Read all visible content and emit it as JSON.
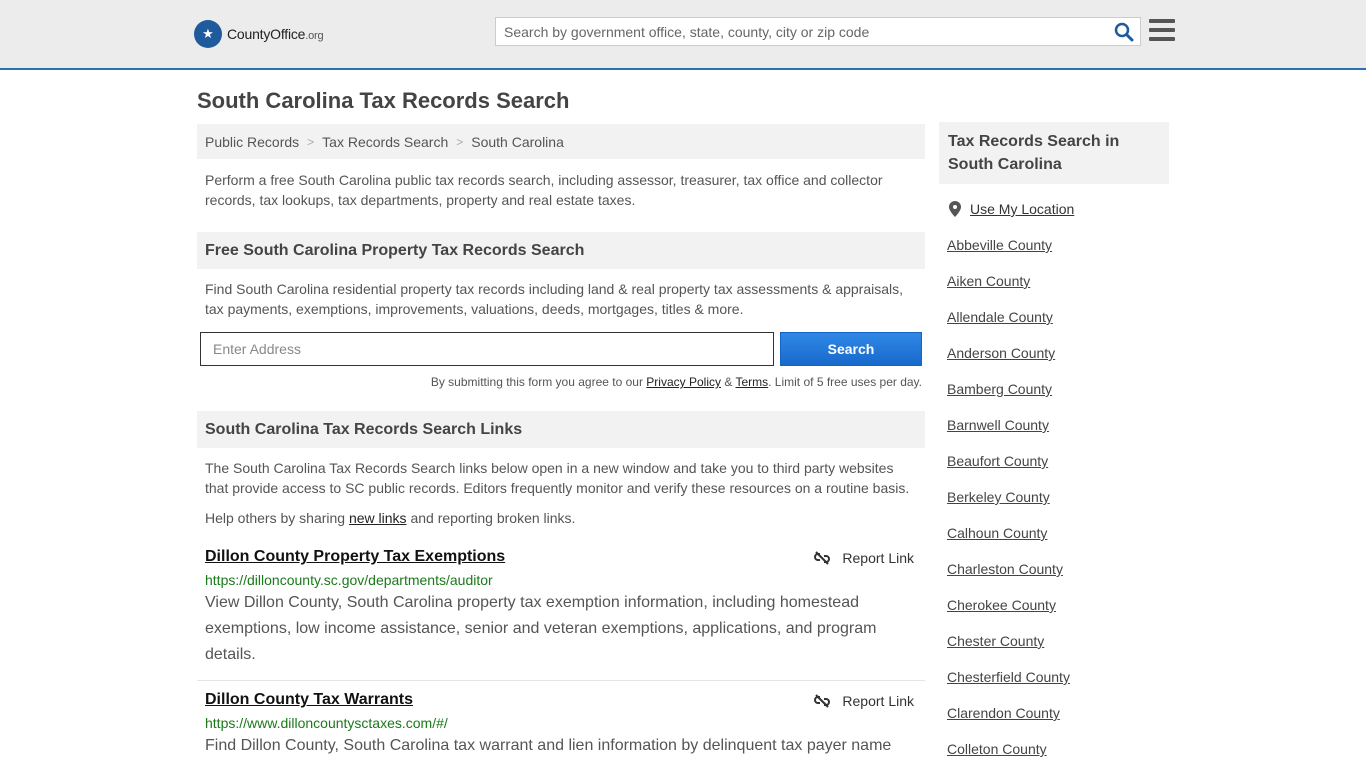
{
  "header": {
    "logo_main": "CountyOffice",
    "logo_tld": ".org",
    "search_placeholder": "Search by government office, state, county, city or zip code"
  },
  "page": {
    "title": "South Carolina Tax Records Search",
    "breadcrumb": [
      "Public Records",
      "Tax Records Search",
      "South Carolina"
    ],
    "intro": "Perform a free South Carolina public tax records search, including assessor, treasurer, tax office and collector records, tax lookups, tax departments, property and real estate taxes."
  },
  "property_search": {
    "heading": "Free South Carolina Property Tax Records Search",
    "description": "Find South Carolina residential property tax records including land & real property tax assessments & appraisals, tax payments, exemptions, improvements, valuations, deeds, mortgages, titles & more.",
    "input_placeholder": "Enter Address",
    "button_label": "Search",
    "terms_prefix": "By submitting this form you agree to our",
    "privacy_label": "Privacy Policy",
    "terms_amp": "&",
    "terms_label": "Terms",
    "terms_suffix": ". Limit of 5 free uses per day."
  },
  "links_section": {
    "heading": "South Carolina Tax Records Search Links",
    "description": "The South Carolina Tax Records Search links below open in a new window and take you to third party websites that provide access to SC public records. Editors frequently monitor and verify these resources on a routine basis.",
    "help_prefix": "Help others by sharing",
    "help_link": "new links",
    "help_suffix": "and reporting broken links.",
    "report_label": "Report Link",
    "items": [
      {
        "title": "Dillon County Property Tax Exemptions",
        "url": "https://dilloncounty.sc.gov/departments/auditor",
        "description": "View Dillon County, South Carolina property tax exemption information, including homestead exemptions, low income assistance, senior and veteran exemptions, applications, and program details."
      },
      {
        "title": "Dillon County Tax Warrants",
        "url": "https://www.dilloncountysctaxes.com/#/",
        "description": "Find Dillon County, South Carolina tax warrant and lien information by delinquent tax payer name"
      }
    ]
  },
  "sidebar": {
    "heading": "Tax Records Search in South Carolina",
    "location_label": "Use My Location",
    "counties": [
      "Abbeville County",
      "Aiken County",
      "Allendale County",
      "Anderson County",
      "Bamberg County",
      "Barnwell County",
      "Beaufort County",
      "Berkeley County",
      "Calhoun County",
      "Charleston County",
      "Cherokee County",
      "Chester County",
      "Chesterfield County",
      "Clarendon County",
      "Colleton County"
    ]
  }
}
